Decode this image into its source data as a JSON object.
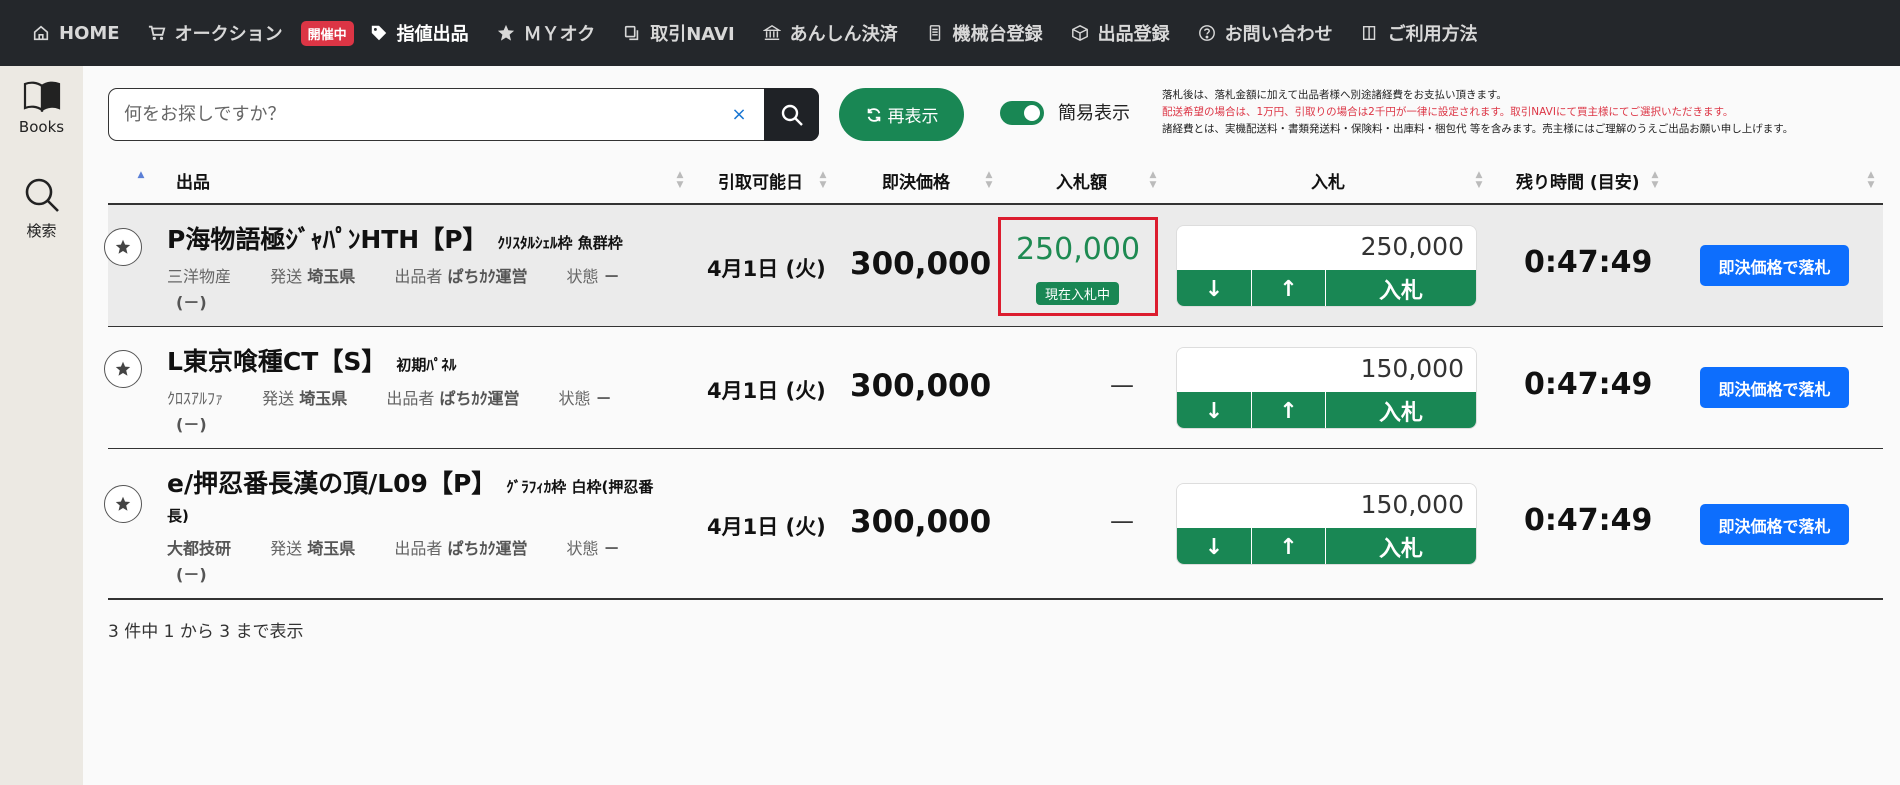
{
  "nav": {
    "items": [
      {
        "label": "HOME",
        "icon": "home-icon"
      },
      {
        "label": "オークション",
        "icon": "cart-icon"
      },
      {
        "label": "指値出品",
        "icon": "tag-icon"
      },
      {
        "label": "ＭＹオク",
        "icon": "star-icon"
      },
      {
        "label": "取引NAVI",
        "icon": "copy-icon"
      },
      {
        "label": "あんしん決済",
        "icon": "bank-icon"
      },
      {
        "label": "機械台登録",
        "icon": "device-icon"
      },
      {
        "label": "出品登録",
        "icon": "box-icon"
      },
      {
        "label": "お問い合わせ",
        "icon": "question-icon"
      },
      {
        "label": "ご利用方法",
        "icon": "book-icon"
      }
    ],
    "live_badge": "開催中"
  },
  "sidebar": {
    "books_label": "Books",
    "search_label": "検索"
  },
  "search": {
    "placeholder": "何をお探しですか？",
    "value": "",
    "clear": "×"
  },
  "toolbar": {
    "reload_label": "再表示",
    "toggle_label": "簡易表示",
    "toggle_on": true
  },
  "notes": [
    "落札後は、落札金額に加えて出品者様へ別途諸経費をお支払い頂きます。",
    "配送希望の場合は、1万円、引取りの場合は2千円が一律に設定されます。取引NAVIにて買主様にてご選択いただきます。",
    "諸経費とは、実機配送料・書類発送料・保険料・出庫料・梱包代 等を含みます。売主様にはご理解のうえご出品お願い申し上げます。"
  ],
  "table": {
    "headers": {
      "item": "出品",
      "pickup": "引取可能日",
      "buyout": "即決価格",
      "bid_amount": "入札額",
      "bid": "入札",
      "remaining": "残り時間 (目安)"
    },
    "meta_labels": {
      "ship": "発送",
      "seller": "出品者",
      "condition": "状態"
    },
    "rows": [
      {
        "title": "P海物語極ｼﾞｬﾊﾟﾝHTH【P】",
        "subtitle": "ｸﾘｽﾀﾙｼｪﾙ枠 魚群枠",
        "title_cont": "",
        "maker": "三洋物産",
        "ship": "埼玉県",
        "seller": "ぱちｶｸ運営",
        "condition": "－",
        "condition2": "(－)",
        "date": "4月1日 (火)",
        "buyout": "300,000",
        "current_bid": "250,000",
        "bid_badge": "現在入札中",
        "bid_input": "250,000",
        "bid_button": "入札",
        "down": "↓",
        "up": "↑",
        "timer": "0:47:49",
        "buy_button": "即決価格で落札"
      },
      {
        "title": "L東京喰種CT【S】",
        "subtitle": "初期ﾊﾟﾈﾙ",
        "title_cont": "",
        "maker": "ｸﾛｽｱﾙﾌｧ",
        "ship": "埼玉県",
        "seller": "ぱちｶｸ運営",
        "condition": "－",
        "condition2": "(－)",
        "date": "4月1日 (火)",
        "buyout": "300,000",
        "current_bid": "—",
        "bid_input": "150,000",
        "bid_button": "入札",
        "down": "↓",
        "up": "↑",
        "timer": "0:47:49",
        "buy_button": "即決価格で落札"
      },
      {
        "title": "e/押忍番長漢の頂/L09【P】",
        "subtitle": "ｸﾞﾗﾌｨｶ枠 白枠(押忍番",
        "title_cont": "長)",
        "maker": "大都技研",
        "ship": "埼玉県",
        "seller": "ぱちｶｸ運営",
        "condition": "－",
        "condition2": "(－)",
        "date": "4月1日 (火)",
        "buyout": "300,000",
        "current_bid": "—",
        "bid_input": "150,000",
        "bid_button": "入札",
        "down": "↓",
        "up": "↑",
        "timer": "0:47:49",
        "buy_button": "即決価格で落札"
      }
    ]
  },
  "footer": {
    "info": "3 件中 1 から 3 まで表示"
  },
  "colors": {
    "nav_bg": "#24272b",
    "green": "#198754",
    "blue": "#0d6efd",
    "red": "#dc1c2e"
  }
}
